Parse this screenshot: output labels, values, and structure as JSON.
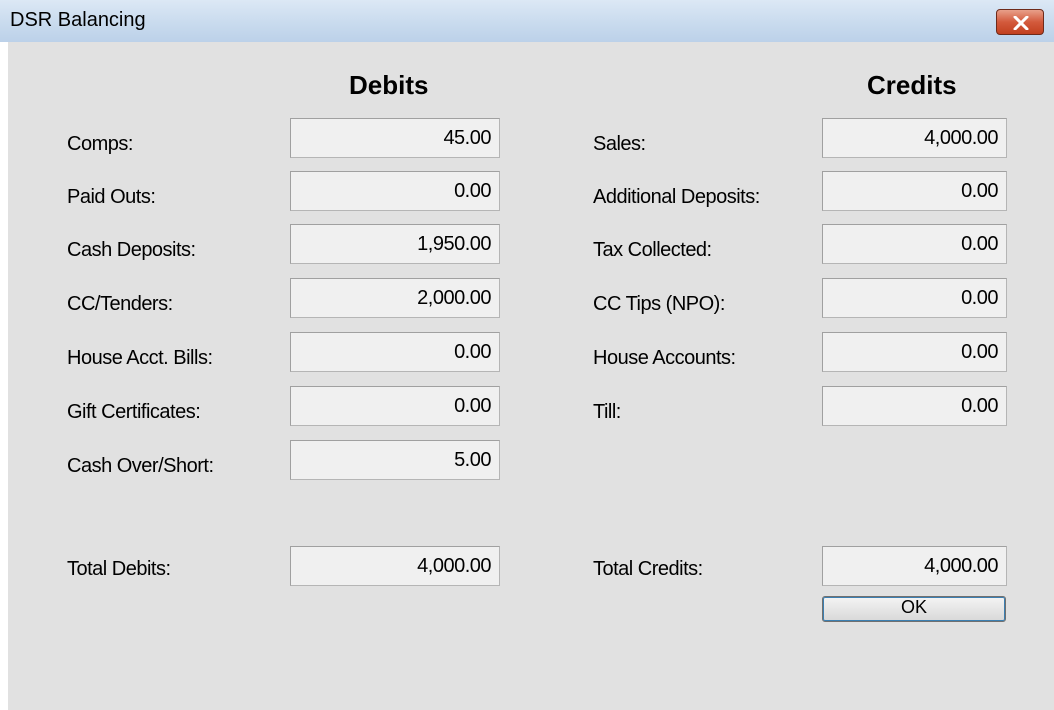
{
  "window": {
    "title": "DSR Balancing"
  },
  "debits": {
    "heading": "Debits",
    "rows": [
      {
        "label": "Comps:",
        "value": "45.00"
      },
      {
        "label": "Paid Outs:",
        "value": "0.00"
      },
      {
        "label": "Cash Deposits:",
        "value": "1,950.00"
      },
      {
        "label": "CC/Tenders:",
        "value": "2,000.00"
      },
      {
        "label": "House Acct. Bills:",
        "value": "0.00"
      },
      {
        "label": "Gift Certificates:",
        "value": "0.00"
      },
      {
        "label": "Cash Over/Short:",
        "value": "5.00"
      }
    ],
    "total_label": "Total Debits:",
    "total_value": "4,000.00"
  },
  "credits": {
    "heading": "Credits",
    "rows": [
      {
        "label": "Sales:",
        "value": "4,000.00"
      },
      {
        "label": "Additional Deposits:",
        "value": "0.00"
      },
      {
        "label": "Tax Collected:",
        "value": "0.00"
      },
      {
        "label": "CC Tips (NPO):",
        "value": "0.00"
      },
      {
        "label": "House Accounts:",
        "value": "0.00"
      },
      {
        "label": "Till:",
        "value": "0.00"
      }
    ],
    "total_label": "Total Credits:",
    "total_value": "4,000.00"
  },
  "buttons": {
    "ok_label": "OK"
  },
  "colors": {
    "close_button": "#c7452a",
    "client_bg": "#e1e1e1",
    "field_bg": "#f0f0f0"
  }
}
